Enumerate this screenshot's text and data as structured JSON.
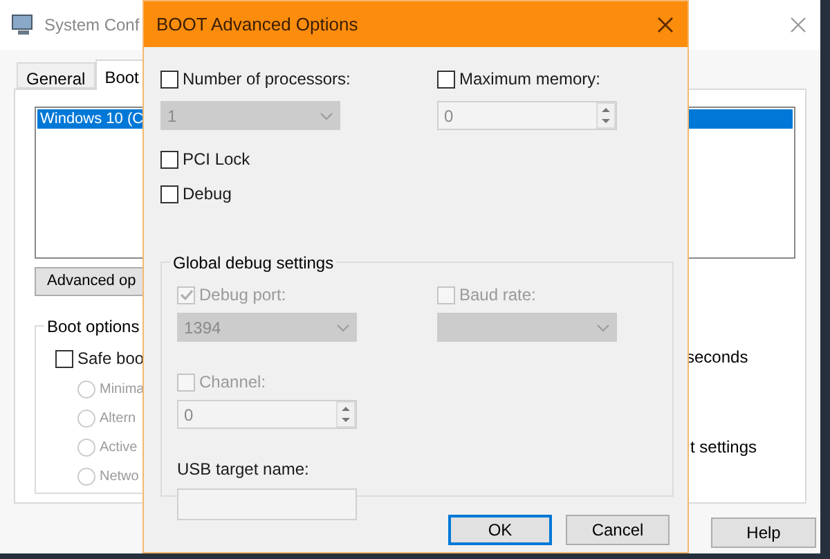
{
  "background_window": {
    "title": "System Conf",
    "tabs": [
      {
        "label": "General",
        "selected": false
      },
      {
        "label": "Boot",
        "selected": true
      }
    ],
    "boot_list": [
      {
        "label": "Windows 10 (C",
        "selected": true
      }
    ],
    "advanced_button": "Advanced op",
    "boot_options": {
      "title": "Boot options",
      "safe_boot": {
        "label": "Safe boo",
        "checked": false
      },
      "radios": [
        {
          "label": "Minima",
          "selected": false,
          "disabled": true
        },
        {
          "label": "Altern",
          "selected": false,
          "disabled": true
        },
        {
          "label": "Active",
          "selected": false,
          "disabled": true
        },
        {
          "label": "Netwo",
          "selected": false,
          "disabled": true
        }
      ]
    },
    "timeout_unit": "seconds",
    "permanent_label": "t settings",
    "buttons": [
      "Help"
    ]
  },
  "dialog": {
    "title": "BOOT Advanced Options",
    "processors": {
      "label": "Number of processors:",
      "checked": false,
      "value": "1",
      "disabled": true
    },
    "max_memory": {
      "label": "Maximum memory:",
      "checked": false,
      "value": "0",
      "disabled": true
    },
    "options": [
      {
        "label": "PCI Lock",
        "checked": false
      },
      {
        "label": "Debug",
        "checked": false
      }
    ],
    "global_debug": {
      "title": "Global debug settings",
      "debug_port": {
        "label": "Debug port:",
        "checked": true,
        "value": "1394",
        "disabled": true
      },
      "baud_rate": {
        "label": "Baud rate:",
        "checked": false,
        "disabled": true
      },
      "channel": {
        "label": "Channel:",
        "checked": false,
        "value": "0",
        "disabled": true
      },
      "usb_target": {
        "label": "USB target name:",
        "disabled": true
      }
    },
    "buttons": [
      {
        "label": "OK",
        "default": true
      },
      {
        "label": "Cancel",
        "default": false
      }
    ]
  }
}
